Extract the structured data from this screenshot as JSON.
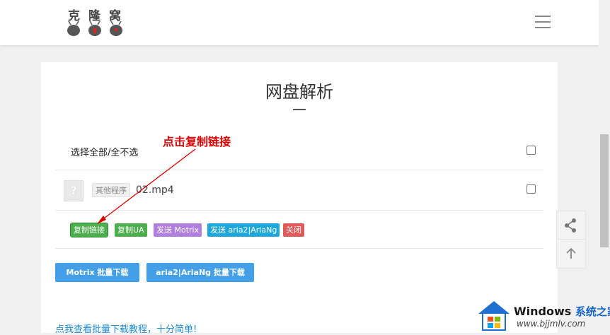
{
  "logo": {
    "text": "克隆窝"
  },
  "page": {
    "title": "网盘解析",
    "select_all_label": "选择全部/全不选",
    "file": {
      "tag": "其他程序",
      "name": "02.mp4",
      "icon": "question-file-icon"
    },
    "actions": {
      "copy_link": "复制链接",
      "copy_ua": "复制UA",
      "send_motrix": "发送 Motrix",
      "send_aria2": "发送 aria2|AriaNg",
      "close": "关闭"
    },
    "batch": {
      "motrix": "Motrix 批量下载",
      "aria2": "aria2|AriaNg 批量下载"
    },
    "tutorial_link": "点我查看批量下载教程，十分简单!"
  },
  "annotation": {
    "text": "点击复制链接",
    "color": "#dd0000"
  },
  "float_buttons": [
    "share-icon",
    "arrow-up-icon"
  ],
  "watermark": {
    "brand": "Windows",
    "brand_cn": "系统之家",
    "url": "www.bjjmlv.com"
  },
  "colors": {
    "green": "#4cae4c",
    "purple": "#b07fe0",
    "cyan": "#1da7da",
    "red": "#e05a5a",
    "blue": "#43a0e8",
    "link": "#1b8bd2"
  }
}
